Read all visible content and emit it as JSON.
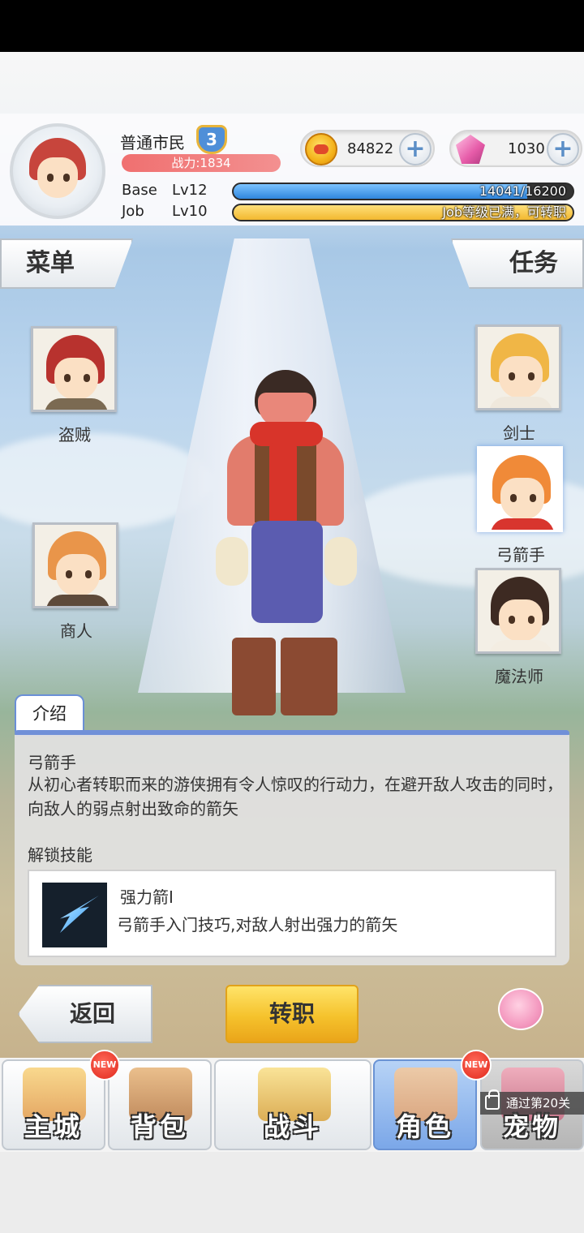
{
  "player": {
    "name": "普通市民",
    "rank_badge": "3",
    "power_text": "战力:1834"
  },
  "resources": {
    "gold": "84822",
    "gems": "1030"
  },
  "levels": {
    "base_label": "Base",
    "base_level": "Lv12",
    "base_exp": "14041/16200",
    "base_fill": 0.867,
    "job_label": "Job",
    "job_level": "Lv10",
    "job_exp": "Job等级已满，可转职",
    "job_fill": 1.0
  },
  "side_tabs": {
    "menu": "菜单",
    "quest": "任务"
  },
  "jobs": {
    "thief": "盗贼",
    "merchant": "商人",
    "swordsman": "剑士",
    "archer": "弓箭手",
    "mage": "魔法师"
  },
  "intro": {
    "tab": "介绍",
    "job_name": "弓箭手",
    "description": "从初心者转职而来的游侠拥有令人惊叹的行动力，在避开敌人攻击的同时，向敌人的弱点射出致命的箭矢",
    "unlock_label": "解锁技能",
    "skill_name": "强力箭Ⅰ",
    "skill_desc": "弓箭手入门技巧,对敌人射出强力的箭矢"
  },
  "actions": {
    "back": "返回",
    "change_job": "转职"
  },
  "nav": {
    "city": "主城",
    "bag": "背包",
    "battle": "战斗",
    "role": "角色",
    "pet": "宠物",
    "new_badge": "NEW",
    "pet_lock": "通过第20关"
  },
  "colors": {
    "accent_blue": "#6a8fd6",
    "button_yellow": "#f5c22c",
    "power_red": "#f07070",
    "base_exp": "#3a8fe0",
    "job_exp": "#f5c340"
  }
}
